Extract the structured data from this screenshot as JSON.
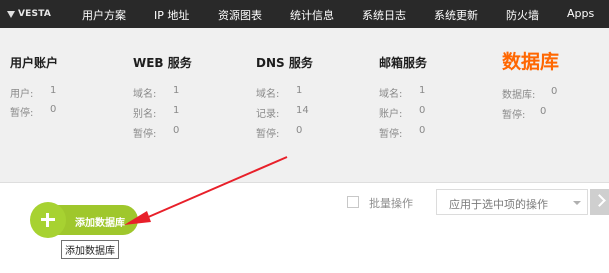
{
  "logo": {
    "text": "VESTA"
  },
  "nav": [
    {
      "label": "用户方案"
    },
    {
      "label": "IP 地址"
    },
    {
      "label": "资源图表"
    },
    {
      "label": "统计信息"
    },
    {
      "label": "系统日志"
    },
    {
      "label": "系统更新"
    },
    {
      "label": "防火墙"
    },
    {
      "label": "Apps"
    }
  ],
  "stats": [
    {
      "title": "用户账户",
      "rows": [
        {
          "label": "用户:",
          "value": "1"
        },
        {
          "label": "暂停:",
          "value": "0"
        }
      ]
    },
    {
      "title": "WEB 服务",
      "rows": [
        {
          "label": "域名:",
          "value": "1"
        },
        {
          "label": "别名:",
          "value": "1"
        },
        {
          "label": "暂停:",
          "value": "0"
        }
      ]
    },
    {
      "title": "DNS 服务",
      "rows": [
        {
          "label": "域名:",
          "value": "1"
        },
        {
          "label": "记录:",
          "value": "14"
        },
        {
          "label": "暂停:",
          "value": "0"
        }
      ]
    },
    {
      "title": "邮箱服务",
      "rows": [
        {
          "label": "域名:",
          "value": "1"
        },
        {
          "label": "账户:",
          "value": "0"
        },
        {
          "label": "暂停:",
          "value": "0"
        }
      ]
    },
    {
      "title": "数据库",
      "active": true,
      "rows": [
        {
          "label": "数据库:",
          "value": "0"
        },
        {
          "label": "暂停:",
          "value": "0"
        }
      ]
    }
  ],
  "toolbar": {
    "batch_label": "批量操作",
    "select_value": "应用于选中项的操作"
  },
  "add_button": {
    "label": "添加数据库",
    "tooltip": "添加数据库"
  },
  "colors": {
    "topnav": "#292929",
    "accent": "#ff6701",
    "add_green": "#9fc72c",
    "annotation_arrow": "#e8202a"
  }
}
